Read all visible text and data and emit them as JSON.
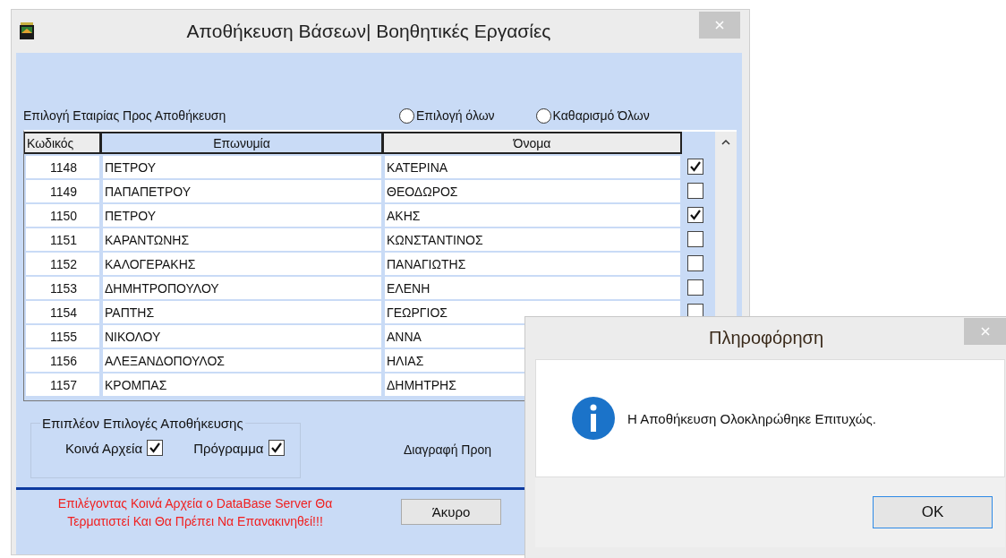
{
  "window": {
    "title": "Αποθήκευση Βάσεων| Βοηθητικές Εργασίες"
  },
  "company_selection": {
    "label": "Επιλογή Εταιρίας Προς Αποθήκευση",
    "options": [
      {
        "label": "Επιλογή όλων",
        "selected": false
      },
      {
        "label": "Καθαρισμό Όλων",
        "selected": false
      }
    ]
  },
  "table": {
    "columns": [
      {
        "label": "Κωδικός",
        "highlighted": false
      },
      {
        "label": "Επωνυμία",
        "highlighted": true
      },
      {
        "label": "Όνομα",
        "highlighted": false
      }
    ],
    "rows": [
      {
        "code": "1148",
        "surname": "ΠΕΤΡΟΥ",
        "name": "ΚΑΤΕΡΙΝΑ",
        "checked": true
      },
      {
        "code": "1149",
        "surname": "ΠΑΠΑΠΕΤΡΟΥ",
        "name": "ΘΕΟΔΩΡΟΣ",
        "checked": false
      },
      {
        "code": "1150",
        "surname": "ΠΕΤΡΟΥ",
        "name": "ΑΚΗΣ",
        "checked": true
      },
      {
        "code": "1151",
        "surname": "ΚΑΡΑΝΤΩΝΗΣ",
        "name": "ΚΩΝΣΤΑΝΤΙΝΟΣ",
        "checked": false
      },
      {
        "code": "1152",
        "surname": "ΚΑΛΟΓΕΡΑΚΗΣ",
        "name": "ΠΑΝΑΓΙΩΤΗΣ",
        "checked": false
      },
      {
        "code": "1153",
        "surname": "ΔΗΜΗΤΡΟΠΟΥΛΟΥ",
        "name": "ΕΛΕΝΗ",
        "checked": false
      },
      {
        "code": "1154",
        "surname": "ΡΑΠΤΗΣ",
        "name": "ΓΕΩΡΓΙΟΣ",
        "checked": false
      },
      {
        "code": "1155",
        "surname": "ΝΙΚΟΛΟΥ",
        "name": "ΑΝΝΑ"
      },
      {
        "code": "1156",
        "surname": "ΑΛΕΞΑΝΔΟΠΟΥΛΟΣ",
        "name": "ΗΛΙΑΣ"
      },
      {
        "code": "1157",
        "surname": "ΚΡΟΜΠΑΣ",
        "name": "ΔΗΜΗΤΡΗΣ"
      }
    ]
  },
  "extra_options": {
    "title": "Επιπλέον Επιλογές Αποθήκευσης",
    "checkboxes": [
      {
        "label": "Κοινά Αρχεία",
        "checked": true
      },
      {
        "label": "Πρόγραμμα",
        "checked": true
      }
    ]
  },
  "delete_label": "Διαγραφή Προη",
  "warning": "Επιλέγοντας Κοινά Αρχεία ο DataBase Server Θα Τερματιστεί Και Θα Πρέπει Να Επανακινηθεί!!!",
  "cancel_button": "Άκυρο",
  "dialog": {
    "title": "Πληροφόρηση",
    "message": "Η Αποθήκευση Ολοκληρώθηκε Επιτυχώς.",
    "ok_button": "OK"
  }
}
